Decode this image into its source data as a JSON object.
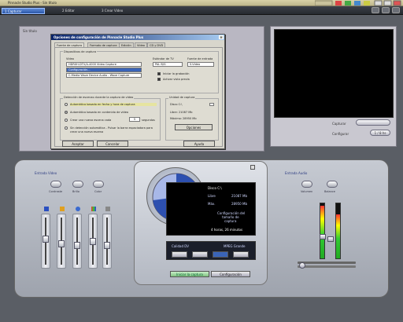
{
  "window": {
    "title": "Pinnacle Studio Plus - Sin título"
  },
  "tabs": [
    {
      "label": "1 Capturar"
    },
    {
      "label": "2 Editar"
    },
    {
      "label": "3 Crear Video"
    }
  ],
  "left_panel": {
    "label": "Sin título"
  },
  "dialog": {
    "title": "Opciones de configuración de Pinnacle Studio Plus",
    "tabs": [
      "Fuente de captura",
      "Formato de captura",
      "Edición",
      "Vídeo",
      "CD y DVD"
    ],
    "group_devices": "Dispositivos de captura",
    "video_label": "Vídeo",
    "video_value": "HDRXH-DTV/A-4000 Video Capture",
    "audio_value": "Configuración...",
    "audio_extra": "C-Media Wave Device Audio - Wave Capture",
    "tv_std_label": "Estándar de TV",
    "tv_std_value": "PAL B/G",
    "tv_src_label": "Fuente de entrada",
    "tv_src_value": "S-Video",
    "cb_capture": "Iniciar la grabación",
    "cb_preview": "Activar vista previa",
    "group_scene": "Detección de escenas durante la captura de vídeo",
    "opt1": "Automático basado en fecha y hora de captura",
    "opt2": "Automático basado en contenido de vídeo",
    "opt3": "Crear una nueva escena cada",
    "opt3_value": "5",
    "opt3_unit": "segundos",
    "opt4": "Sin detección automática - Pulsar la barra espaciadora para crear una nueva escena",
    "group_disk": "Unidad de captura",
    "disk_drive": "Disco C:\\",
    "disk_free": "Libre: 21087 Mb",
    "disk_max": "Máximo: 28950 Mb",
    "disk_btn": "Opciones",
    "ok": "Aceptar",
    "cancel": "Cancelar",
    "help": "Ayuda"
  },
  "right_panel": {
    "label1": "Capturar",
    "label2": "Configurar",
    "btn1": "",
    "btn2": "1 / 8 hs"
  },
  "mixer": {
    "title_left": "Entrada Video",
    "knobs": [
      "Contraste",
      "Brillo",
      "Color"
    ],
    "title_right": "Entrada Audio",
    "knobs_right": [
      "Volumen",
      "Balance"
    ],
    "fader_levels": [
      0.55,
      0.45,
      0.4,
      0.5,
      0.4
    ],
    "meter_levels": [
      0.95,
      0.8
    ],
    "right_fader_levels": [
      0.35,
      0.3
    ]
  },
  "center": {
    "drive_header": "Disco C:\\",
    "line1": "Libre",
    "line1_val": "21087 Mb",
    "line2": "Máx.",
    "line2_val": "28950 Mb",
    "quality_line1": "Configuración del",
    "quality_line2": "tamaño de",
    "quality_line3": "captura",
    "time": "4 horas, 26 minutos",
    "fmt_left": "Calidad DV",
    "fmt_right": "MPEG Grande",
    "btn_start": "Iniciar la captura",
    "btn_format": "Configuración"
  },
  "colors": {
    "accent": "#2b57a8",
    "lcd": "#000000",
    "dial_fill": "#2d50b0"
  }
}
